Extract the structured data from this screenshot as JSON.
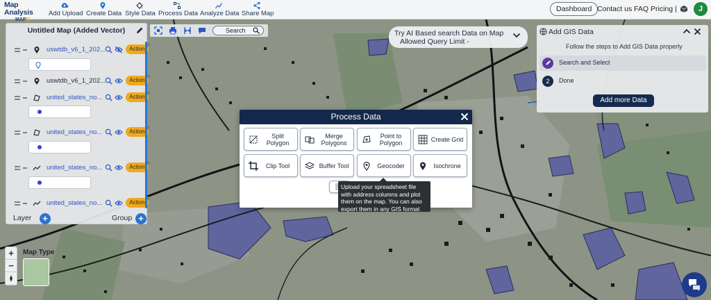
{
  "logo": {
    "line1": "Map Analysis",
    "line2_a": "MAP",
    "line2_b": "O"
  },
  "nav": [
    {
      "label": "Add Upload",
      "icon": "cloud-upload-icon"
    },
    {
      "label": "Create Data",
      "icon": "map-pin-icon"
    },
    {
      "label": "Style Data",
      "icon": "paint-bucket-icon"
    },
    {
      "label": "Process Data",
      "icon": "process-icon"
    },
    {
      "label": "Analyze Data",
      "icon": "analyze-icon"
    },
    {
      "label": "Share Map",
      "icon": "share-icon"
    }
  ],
  "top_right": {
    "dashboard": "Dashboard",
    "contact": "Contact us",
    "faq": "FAQ",
    "pricing": "Pricing |",
    "avatar": "J"
  },
  "layers_panel": {
    "title": "Untitled Map (Added Vector)",
    "items": [
      {
        "name": "uswtdb_v6_1_202...",
        "action": "Action",
        "kind": "point",
        "visible": false
      },
      {
        "name": "uswtdb_v6_1_202...",
        "action": "Action",
        "kind": "point",
        "visible": true
      },
      {
        "name": "united_states_no...",
        "action": "Action",
        "kind": "polygon",
        "visible": true
      },
      {
        "name": "united_states_no...",
        "action": "Action",
        "kind": "polygon",
        "visible": true
      },
      {
        "name": "united_states_no...",
        "action": "Action",
        "kind": "line",
        "visible": true
      },
      {
        "name": "united_states_no...",
        "action": "Action",
        "kind": "line",
        "visible": true
      }
    ],
    "footer_layer": "Layer",
    "footer_group": "Group"
  },
  "map_tools": {
    "search_label": "Search"
  },
  "ai_bar": {
    "line1": "Try AI Based search Data on Map",
    "line2": "Allowed Query Limit -"
  },
  "gis_panel": {
    "title": "Add GIS Data",
    "subtitle": "Follow the steps to Add GIS Data properly",
    "steps": [
      {
        "num": "",
        "label": "Search and Select"
      },
      {
        "num": "2",
        "label": "Done"
      }
    ],
    "add_button": "Add more Data"
  },
  "modal": {
    "title": "Process Data",
    "tools": [
      {
        "label": "Split Polygon",
        "icon": "split-polygon-icon"
      },
      {
        "label": "Merge Polygons",
        "icon": "merge-polygons-icon"
      },
      {
        "label": "Point to Polygon",
        "icon": "point-to-polygon-icon"
      },
      {
        "label": "Create Grid",
        "icon": "grid-icon"
      },
      {
        "label": "Clip Tool",
        "icon": "crop-icon"
      },
      {
        "label": "Buffer Tool",
        "icon": "buffer-icon"
      },
      {
        "label": "Geocoder",
        "icon": "geocoder-icon"
      },
      {
        "label": "Isochrone",
        "icon": "isochrone-icon"
      }
    ],
    "tooltip": "Upload your spreadsheet file with address columns and plot them on the map. You can also export them in any GIS format"
  },
  "map_controls": {
    "zoom_in": "+",
    "zoom_out": "−",
    "map_type": "Map Type"
  },
  "colors": {
    "navy": "#13284a",
    "accent": "#f0a81c",
    "link": "#2a56c6",
    "polygon": "#5a63c8"
  }
}
